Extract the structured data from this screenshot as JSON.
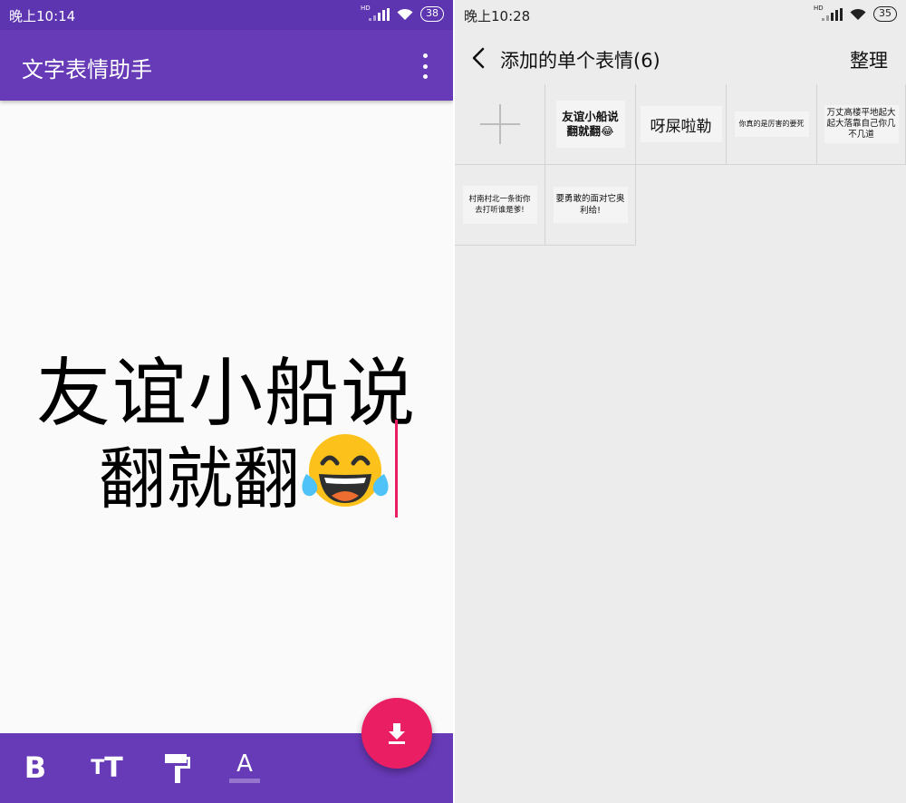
{
  "left_screen": {
    "status_bar": {
      "time": "晚上10:14",
      "hd": "HD",
      "battery": "38"
    },
    "app_bar": {
      "title": "文字表情助手",
      "menu_icon": "more-vert-icon"
    },
    "canvas": {
      "line1": "友谊小船说",
      "line2": "翻就翻",
      "emoji": "face-with-tears-of-joy-icon"
    },
    "fab": {
      "icon": "download-icon"
    },
    "toolbar": {
      "bold_label": "B",
      "size_big": "T",
      "size_small": "T",
      "paint_icon": "paint-roller-icon",
      "color_label": "A"
    },
    "colors": {
      "primary": "#673ab7",
      "status": "#5e35b1",
      "accent": "#e91e63"
    }
  },
  "right_screen": {
    "status_bar": {
      "time": "晚上10:28",
      "hd": "HD",
      "battery": "35"
    },
    "header": {
      "title": "添加的单个表情(6)",
      "action": "整理",
      "back_icon": "chevron-left-icon"
    },
    "grid": {
      "add_icon": "plus-icon",
      "stickers": [
        "友谊小船说翻就翻😂",
        "呀屎啦勒",
        "你真的是厉害的要死",
        "万丈高楼平地起大起大落靠自己你几不几道",
        "村南村北一条街你去打听谁是爹!",
        "要勇敢的面对它奥利给!"
      ]
    }
  }
}
